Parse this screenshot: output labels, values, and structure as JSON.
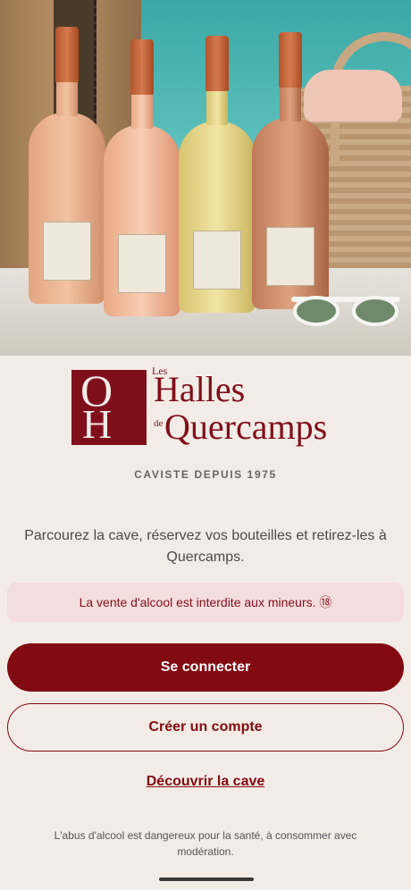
{
  "hero": {
    "icon": "wine-bottles-photo"
  },
  "logo": {
    "mark_top": "O",
    "mark_bottom": "H",
    "line1": "Les",
    "line2": "Halles",
    "line3": "de",
    "line4": "Quercamps"
  },
  "tagline": "CAVISTE DEPUIS 1975",
  "intro": "Parcourez la cave, réservez vos bouteilles et retirez-les à Quercamps.",
  "warning": "La vente d'alcool est interdite aux mineurs. ⑱",
  "actions": {
    "login_label": "Se connecter",
    "signup_label": "Créer un compte",
    "discover_label": "Découvrir la cave"
  },
  "disclaimer": "L'abus d'alcool est dangereux pour la santé, à consommer avec modération.",
  "colors": {
    "brand": "#820a12",
    "background": "#f3ece6",
    "warning_bg": "#f4dddd"
  }
}
